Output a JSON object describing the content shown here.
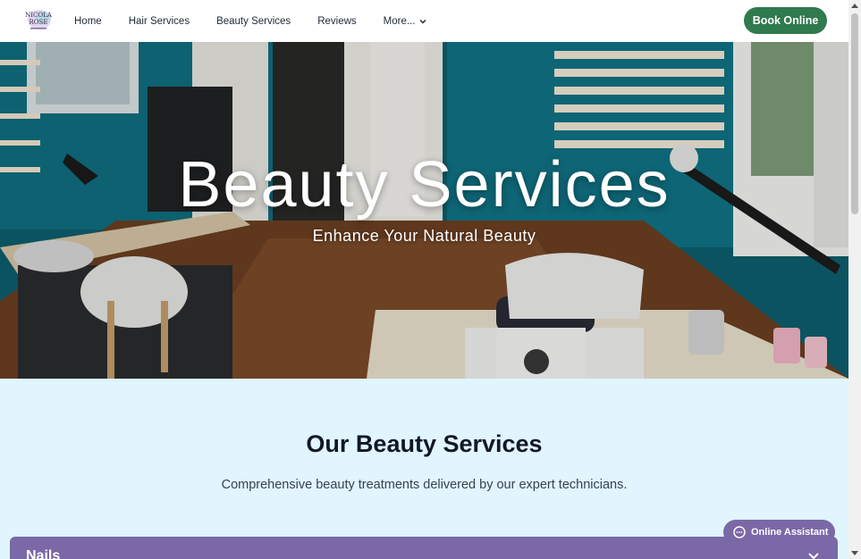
{
  "nav": {
    "logo_icon": "salon-logo-icon",
    "links": [
      "Home",
      "Hair Services",
      "Beauty Services",
      "Reviews"
    ],
    "more_label": "More...",
    "more_icon": "chevron-down-icon",
    "book_label": "Book Online"
  },
  "hero": {
    "title": "Beauty Services",
    "subtitle": "Enhance Your Natural Beauty"
  },
  "services": {
    "title": "Our Beauty Services",
    "subtitle": "Comprehensive beauty treatments delivered by our expert technicians.",
    "accordion": {
      "label": "Nails",
      "icon": "chevron-down-icon"
    }
  },
  "assistant": {
    "label": "Online Assistant",
    "icon": "chat-bubble-icon"
  },
  "colors": {
    "accent_green": "#2f7a4e",
    "accent_purple": "#7b68a6",
    "section_bg": "#e0f5fd",
    "wall_teal": "#0f6f80"
  }
}
